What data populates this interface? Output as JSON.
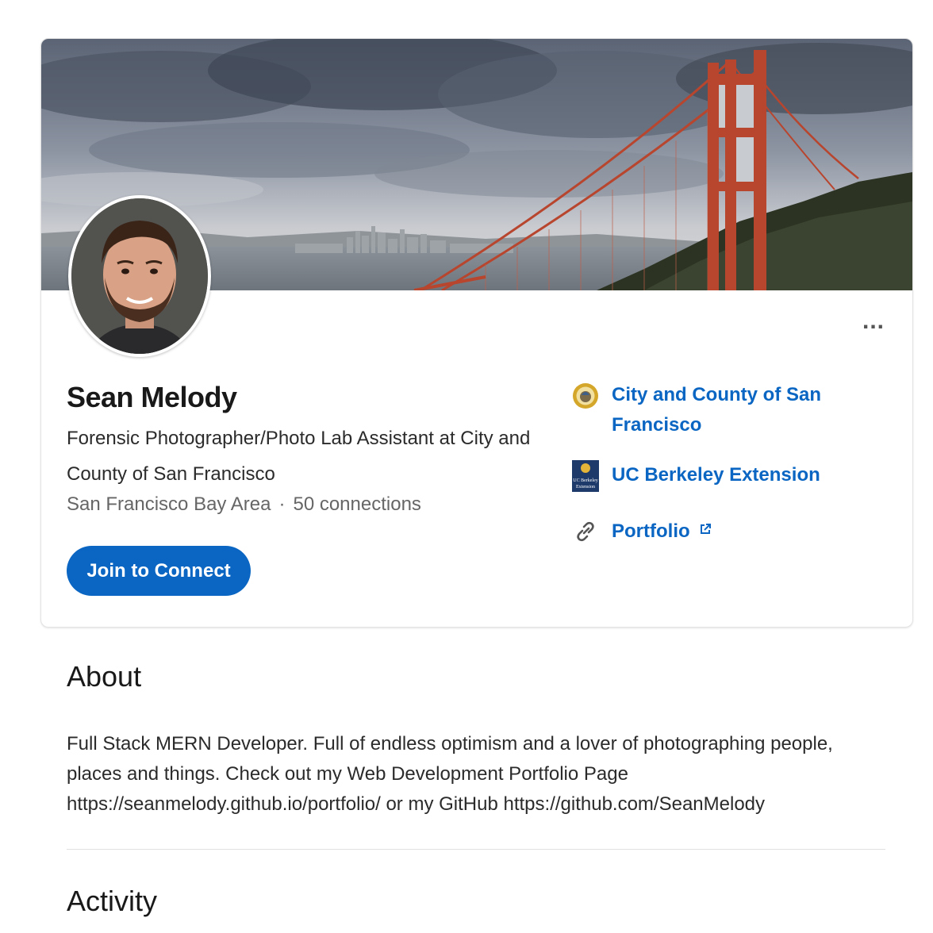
{
  "profile": {
    "name": "Sean Melody",
    "headline": "Forensic Photographer/Photo Lab Assistant at City and County of San Francisco",
    "location": "San Francisco Bay Area",
    "separator": "·",
    "connections": "50 connections",
    "join_label": "Join to Connect",
    "more_label": "..."
  },
  "side_links": [
    {
      "label": "City and County of San Francisco",
      "icon": "sf-seal-icon"
    },
    {
      "label": "UC Berkeley Extension",
      "icon": "uc-berkeley-extension-logo"
    },
    {
      "label": "Portfolio",
      "icon": "link-icon",
      "trailing_icon": "external-link-icon"
    }
  ],
  "logos": {
    "uc_berkeley_line1": "UC Berkeley",
    "uc_berkeley_line2": "Extension"
  },
  "about": {
    "title": "About",
    "text": "Full Stack MERN Developer. Full of endless optimism and a lover of photographing people, places and things. Check out my Web Development Portfolio Page https://seanmelody.github.io/portfolio/ or my GitHub https://github.com/SeanMelody"
  },
  "activity": {
    "title": "Activity"
  },
  "colors": {
    "accent": "#0a66c2",
    "text": "#191919",
    "muted": "#666666",
    "bridge": "#b8452e"
  }
}
